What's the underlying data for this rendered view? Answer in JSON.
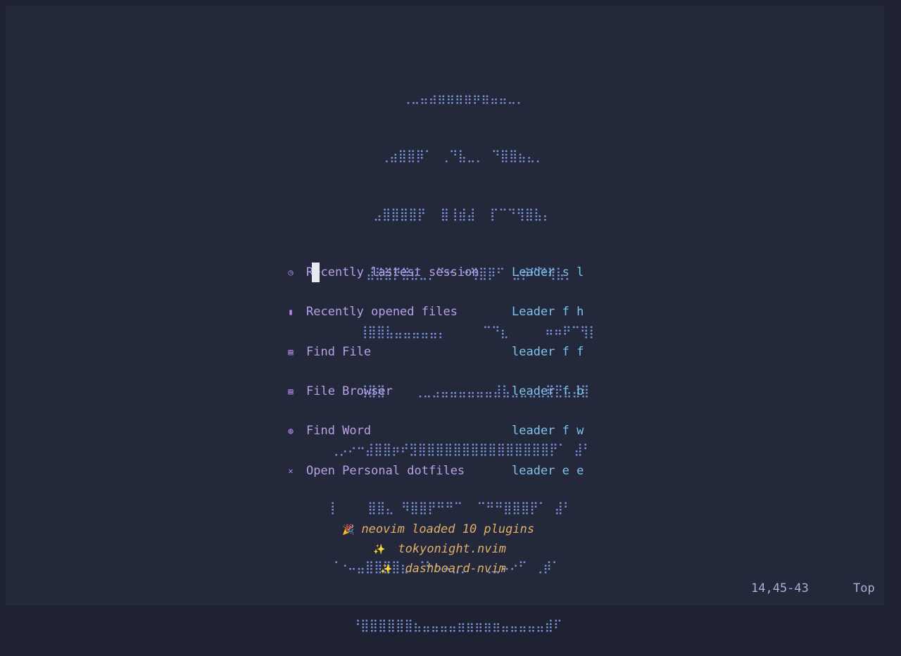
{
  "header_art": [
    "          ⢀⣀⣤⣴⣶⣶⣶⣶⡶⣶⣤⣤⣀⡀",
    "       ⢀⣴⣿⣿⡿⠁ ⢀⠙⣧⣀⡀ ⠙⣿⣿⣦⣄⡀",
    "      ⣠⣿⣿⣿⣿⡟  ⣿⢸⣾⣼  ⡏⠉⠙⢻⣿⣧⡄",
    "     ⣼⣿⣿⡟⣿⣦⣀⡀⠙⠒ ⠒⢻⣿⡿⠋ ⣠⡾⠋⠙⢿⣧⡀",
    "    ⢸⣿⣿⣧⣤⣤⣤⣤⣤⡄     ⠉⠙⣆     ⠶⠶⠟⠉⢻⡇",
    "    ⢸⣿⣿    ⢀⣀⣠⣤⣤⣤⣤⣤⣤⣼⣧⣀⣀⣀⣀⣿⣟⣤⣼⣿",
    "⢀⡠⠔⠒⣼⣿⣿⡶⠞⣻⣿⣿⣿⣿⣿⣿⣿⣿⣿⣿⣿⣿⣿⣿⣿⡟⠁ ⣼⠃",
    "⡇    ⣿⣿⣄ ⠻⣿⣿⡟⠛⠛⠉  ⠉⠛⠛⣿⣿⣿⡟⠁ ⣼⠃",
    "⠈⠐⠤⣤⣿⣿⣿⣿⣆ ⠈⠓⠢⠤⣀⡀  ⢀⣀⠤⠔⠋ ⢀⡾⠁",
    "   ⠘⣿⣿⣿⣿⣿⣿⣦⣤⣤⣤⣤⣶⣶⣶⣶⣶⣤⣤⣤⣤⣤⣾⠏"
  ],
  "menu": [
    {
      "icon": "clock-icon",
      "glyph": "◷",
      "label": "Recently lastest session",
      "shortcut": "Leader s l"
    },
    {
      "icon": "files-icon",
      "glyph": "▮",
      "label": "Recently opened files",
      "shortcut": "Leader f h"
    },
    {
      "icon": "file-icon",
      "glyph": "▤",
      "label": "Find File",
      "shortcut": "leader f f"
    },
    {
      "icon": "file-browser-icon",
      "glyph": "▤",
      "label": "File Browser",
      "shortcut": "leader f b"
    },
    {
      "icon": "word-icon",
      "glyph": "◍",
      "label": "Find Word",
      "shortcut": "leader f w"
    },
    {
      "icon": "tools-icon",
      "glyph": "✕",
      "label": "Open Personal dotfiles",
      "shortcut": "leader e e"
    }
  ],
  "footer": {
    "loaded": {
      "emoji": "🎉",
      "text": "neovim loaded 10 plugins"
    },
    "plugins": [
      {
        "emoji": "✨",
        "text": "tokyonight.nvim"
      },
      {
        "emoji": "✨",
        "text": "dashboard-nvim"
      }
    ]
  },
  "status": {
    "position": "14,45-43",
    "scroll": "Top"
  },
  "colors": {
    "background": "#24283b",
    "art": "#7a93d8",
    "label": "#b8a2ea",
    "shortcut": "#7cc4ec",
    "footer": "#e0af68"
  }
}
